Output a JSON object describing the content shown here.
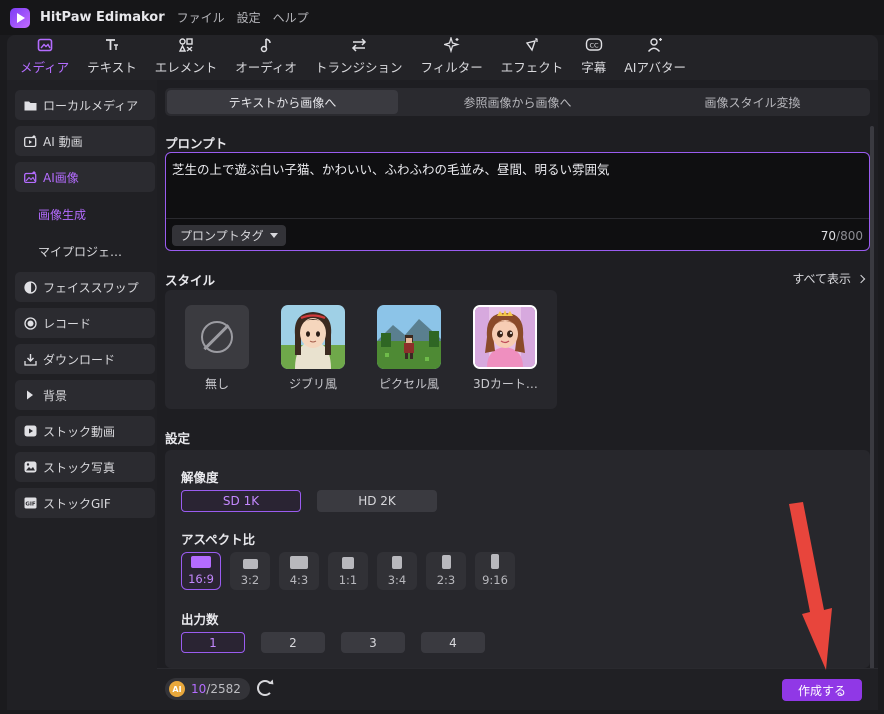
{
  "titlebar": {
    "app_name": "HitPaw Edimakor",
    "menu": [
      "ファイル",
      "設定",
      "ヘルプ"
    ]
  },
  "toolbar": {
    "items": [
      {
        "label": "メディア",
        "icon": "media-icon",
        "active": true
      },
      {
        "label": "テキスト",
        "icon": "text-icon",
        "active": false
      },
      {
        "label": "エレメント",
        "icon": "element-icon",
        "active": false
      },
      {
        "label": "オーディオ",
        "icon": "audio-icon",
        "active": false
      },
      {
        "label": "トランジション",
        "icon": "transition-icon",
        "active": false
      },
      {
        "label": "フィルター",
        "icon": "filter-icon",
        "active": false
      },
      {
        "label": "エフェクト",
        "icon": "effect-icon",
        "active": false
      },
      {
        "label": "字幕",
        "icon": "subtitle-icon",
        "active": false
      },
      {
        "label": "AIアバター",
        "icon": "avatar-icon",
        "active": false
      }
    ]
  },
  "sidebar": {
    "items": [
      {
        "label": "ローカルメディア",
        "icon": "folder-icon"
      },
      {
        "label": "AI 動画",
        "icon": "ai-video-icon"
      },
      {
        "label": "AI画像",
        "icon": "ai-image-icon",
        "active": true
      },
      {
        "label": "フェイススワップ",
        "icon": "face-swap-icon"
      },
      {
        "label": "レコード",
        "icon": "record-icon"
      },
      {
        "label": "ダウンロード",
        "icon": "download-icon"
      },
      {
        "label": "背景",
        "icon": "triangle-right-icon"
      },
      {
        "label": "ストック動画",
        "icon": "stock-video-icon"
      },
      {
        "label": "ストック写真",
        "icon": "stock-photo-icon"
      },
      {
        "label": "ストックGIF",
        "icon": "gif-icon"
      }
    ],
    "sub_items": [
      {
        "label": "画像生成",
        "active": true
      },
      {
        "label": "マイプロジェ…",
        "active": false
      }
    ]
  },
  "main": {
    "tabs": [
      {
        "label": "テキストから画像へ",
        "active": true
      },
      {
        "label": "参照画像から画像へ",
        "active": false
      },
      {
        "label": "画像スタイル変換",
        "active": false
      }
    ],
    "prompt": {
      "label": "プロンプト",
      "text": "芝生の上で遊ぶ白い子猫、かわいい、ふわふわの毛並み、昼間、明るい雰囲気",
      "tag_button": "プロンプトタグ",
      "count_current": "70",
      "count_max": "/800"
    },
    "style": {
      "label": "スタイル",
      "show_all": "すべて表示",
      "options": [
        {
          "name": "無し"
        },
        {
          "name": "ジブリ風"
        },
        {
          "name": "ピクセル風"
        },
        {
          "name": "3Dカート…",
          "selected": true
        }
      ]
    },
    "settings": {
      "label": "設定",
      "resolution_label": "解像度",
      "resolutions": [
        "SD 1K",
        "HD 2K"
      ],
      "aspect_label": "アスペクト比",
      "aspects": [
        "16:9",
        "3:2",
        "4:3",
        "1:1",
        "3:4",
        "2:3",
        "9:16"
      ],
      "output_label": "出力数",
      "outputs": [
        "1",
        "2",
        "3",
        "4"
      ]
    },
    "footer": {
      "coin_label": "AI",
      "credits_current": "10",
      "credits_total": "/2582",
      "create_button": "作成する"
    }
  },
  "colors": {
    "accent": "#9a5cf0",
    "accent_text": "#b46cff",
    "create_button": "#9038e6",
    "annotation_arrow": "#e8453c"
  }
}
